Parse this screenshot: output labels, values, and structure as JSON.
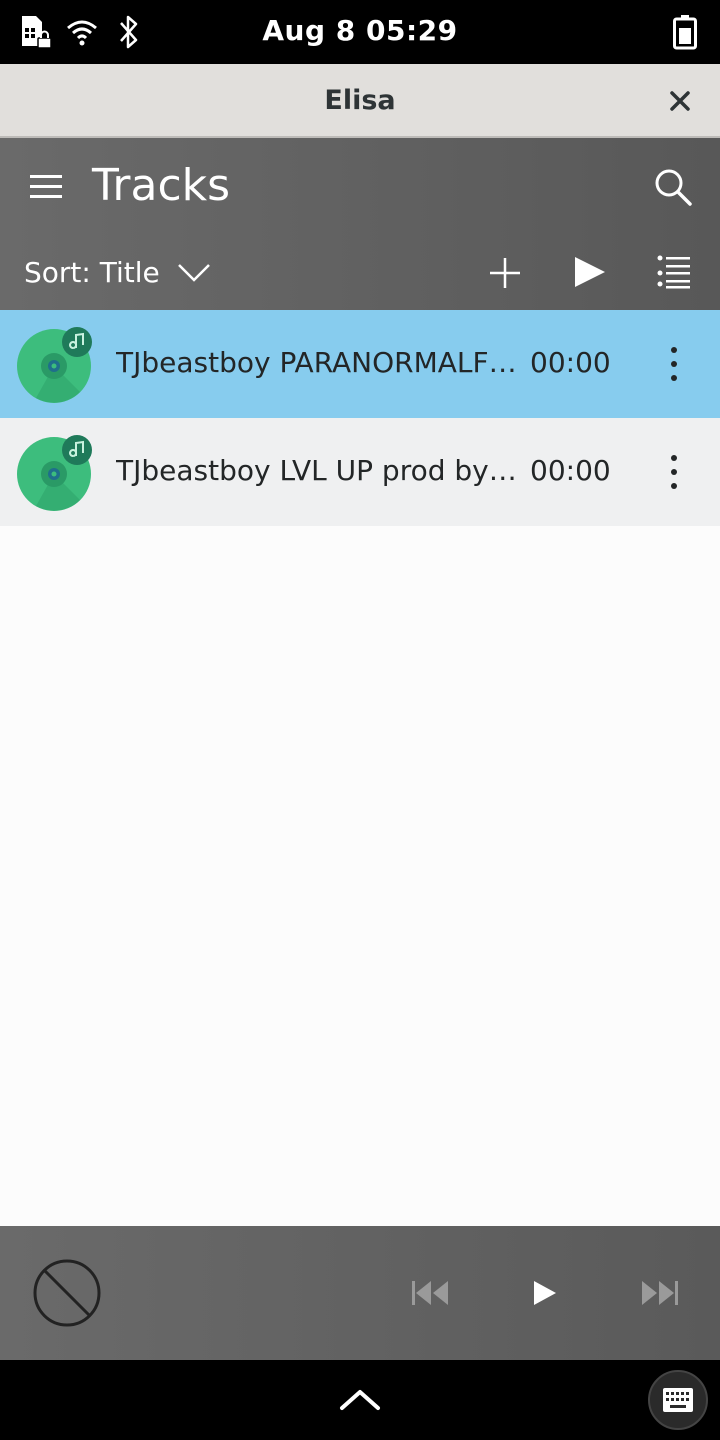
{
  "status_bar": {
    "datetime": "Aug 8  05:29",
    "icons": [
      "sim-locked-icon",
      "wifi-icon",
      "bluetooth-icon",
      "battery-icon"
    ]
  },
  "window": {
    "title": "Elisa",
    "close_icon": "close-icon"
  },
  "header": {
    "title": "Tracks",
    "sort_label": "Sort: Title",
    "icons": [
      "hamburger-menu-icon",
      "search-icon",
      "chevron-down-icon",
      "add-icon",
      "play-icon",
      "playlist-icon"
    ]
  },
  "tracks": [
    {
      "title": "TJbeastboy PARANORMALF…",
      "duration": "00:00",
      "selected": true
    },
    {
      "title": "TJbeastboy LVL UP prod by T…",
      "duration": "00:00",
      "selected": false
    }
  ],
  "player": {
    "icons": [
      "no-media-icon",
      "previous-icon",
      "play-icon",
      "next-icon"
    ]
  },
  "nav": {
    "icons": [
      "chevron-up-icon",
      "keyboard-icon"
    ]
  },
  "colors": {
    "selected_row": "#87ccee",
    "header_bg": "#606060",
    "cover_green": "#3dbd7d"
  }
}
